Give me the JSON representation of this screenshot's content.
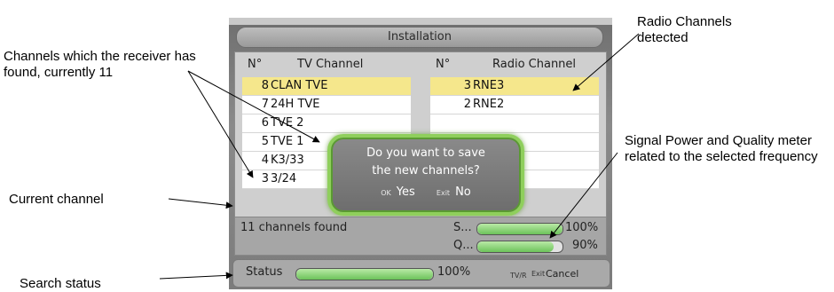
{
  "annotations": {
    "channels_found": "Channels which the receiver has found, currently 11",
    "radio_detected": "Radio Channels detected",
    "signal_meter": "Signal Power and Quality meter related to the selected frequency",
    "current_channel": "Current channel",
    "search_status": "Search status"
  },
  "screen": {
    "title": "Installation",
    "tv": {
      "num_header": "N°",
      "name_header": "TV Channel",
      "rows": [
        {
          "num": "8",
          "name": "CLAN TVE"
        },
        {
          "num": "7",
          "name": "24H TVE"
        },
        {
          "num": "6",
          "name": "TVE 2"
        },
        {
          "num": "5",
          "name": "TVE 1"
        },
        {
          "num": "4",
          "name": "K3/33"
        },
        {
          "num": "3",
          "name": "3/24"
        }
      ]
    },
    "radio": {
      "num_header": "N°",
      "name_header": "Radio Channel",
      "rows": [
        {
          "num": "3",
          "name": "RNE3"
        },
        {
          "num": "2",
          "name": "RNE2"
        }
      ]
    },
    "dialog": {
      "question_line1": "Do you want to save",
      "question_line2": "the new channels?",
      "ok_key": "OK",
      "yes_label": "Yes",
      "exit_key": "Exit",
      "no_label": "No"
    },
    "found_text": "11 channels found",
    "signal": {
      "s_label": "S...",
      "s_value": "100%",
      "s_level": 1.0,
      "q_label": "Q...",
      "q_value": "90%",
      "q_level": 0.9
    },
    "status": {
      "label": "Status",
      "value": "100%",
      "level": 1.0,
      "tvr_key": "TV/R",
      "exit_key": "Exit",
      "cancel_label": "Cancel"
    }
  }
}
